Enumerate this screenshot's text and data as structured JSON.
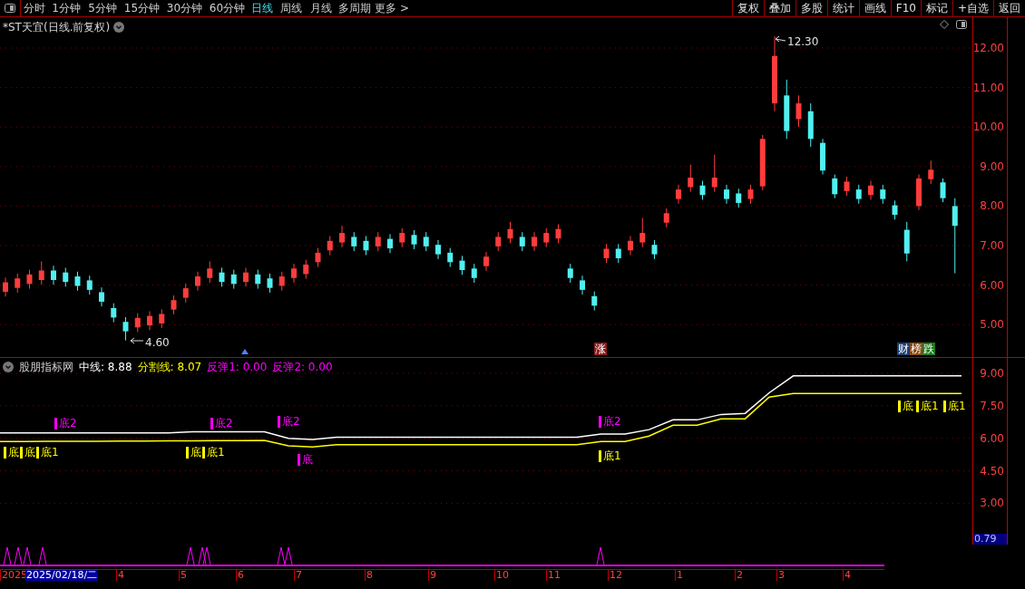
{
  "toolbar": {
    "periods": [
      {
        "label": "分时",
        "selected": false
      },
      {
        "label": "1分钟",
        "selected": false
      },
      {
        "label": "5分钟",
        "selected": false
      },
      {
        "label": "15分钟",
        "selected": false
      },
      {
        "label": "30分钟",
        "selected": false
      },
      {
        "label": "60分钟",
        "selected": false
      },
      {
        "label": "日线",
        "selected": true
      },
      {
        "label": "周线",
        "selected": false
      },
      {
        "label": "月线",
        "selected": false
      },
      {
        "label": "多周期",
        "selected": false
      },
      {
        "label": "更多 >",
        "selected": false
      }
    ],
    "buttons": [
      "复权",
      "叠加",
      "多股",
      "统计",
      "画线",
      "F10",
      "标记",
      "+自选",
      "返回"
    ]
  },
  "chart": {
    "title": "*ST天宜(日线.前复权)",
    "high_label": "12.30",
    "low_label": "4.60",
    "chart_data": {
      "type": "candlestick",
      "grid": true,
      "ylim": [
        4.18,
        12.78
      ],
      "yticks": [
        {
          "value": 12,
          "label": "12.00"
        },
        {
          "value": 11,
          "label": "11.00"
        },
        {
          "value": 10,
          "label": "10.00"
        },
        {
          "value": 9,
          "label": "9.00"
        },
        {
          "value": 8,
          "label": "8.00"
        },
        {
          "value": 7,
          "label": "7.00"
        },
        {
          "value": 6,
          "label": "6.00"
        },
        {
          "value": 5,
          "label": "5.00"
        }
      ],
      "ohlc": [
        [
          5.83,
          6.19,
          5.71,
          6.07
        ],
        [
          5.93,
          6.29,
          5.81,
          6.17
        ],
        [
          6.03,
          6.39,
          5.91,
          6.27
        ],
        [
          6.13,
          6.6,
          6.01,
          6.37
        ],
        [
          6.37,
          6.49,
          6.01,
          6.13
        ],
        [
          6.32,
          6.44,
          5.96,
          6.08
        ],
        [
          6.22,
          6.34,
          5.86,
          5.98
        ],
        [
          6.12,
          6.24,
          5.76,
          5.88
        ],
        [
          5.82,
          5.94,
          5.46,
          5.58
        ],
        [
          5.42,
          5.54,
          5.06,
          5.18
        ],
        [
          5.07,
          5.19,
          4.6,
          4.83
        ],
        [
          4.93,
          5.29,
          4.81,
          5.17
        ],
        [
          4.98,
          5.34,
          4.86,
          5.22
        ],
        [
          5.03,
          5.39,
          4.91,
          5.27
        ],
        [
          5.38,
          5.74,
          5.26,
          5.62
        ],
        [
          5.68,
          6.04,
          5.56,
          5.92
        ],
        [
          5.98,
          6.34,
          5.86,
          6.22
        ],
        [
          6.18,
          6.6,
          6.06,
          6.42
        ],
        [
          6.32,
          6.44,
          5.96,
          6.08
        ],
        [
          6.27,
          6.39,
          5.91,
          6.03
        ],
        [
          6.08,
          6.44,
          5.96,
          6.32
        ],
        [
          6.27,
          6.39,
          5.91,
          6.03
        ],
        [
          6.17,
          6.29,
          5.81,
          5.93
        ],
        [
          5.98,
          6.34,
          5.86,
          6.22
        ],
        [
          6.18,
          6.54,
          6.06,
          6.42
        ],
        [
          6.28,
          6.64,
          6.16,
          6.52
        ],
        [
          6.58,
          6.94,
          6.46,
          6.82
        ],
        [
          6.88,
          7.24,
          6.76,
          7.12
        ],
        [
          7.08,
          7.5,
          6.96,
          7.32
        ],
        [
          7.22,
          7.34,
          6.86,
          6.98
        ],
        [
          7.12,
          7.24,
          6.76,
          6.88
        ],
        [
          6.98,
          7.34,
          6.86,
          7.22
        ],
        [
          7.17,
          7.29,
          6.81,
          6.93
        ],
        [
          7.08,
          7.44,
          6.96,
          7.32
        ],
        [
          7.27,
          7.39,
          6.91,
          7.03
        ],
        [
          7.22,
          7.34,
          6.86,
          6.98
        ],
        [
          7.02,
          7.14,
          6.66,
          6.78
        ],
        [
          6.82,
          6.94,
          6.46,
          6.58
        ],
        [
          6.62,
          6.74,
          6.26,
          6.38
        ],
        [
          6.42,
          6.54,
          6.06,
          6.18
        ],
        [
          6.48,
          6.84,
          6.36,
          6.72
        ],
        [
          6.98,
          7.34,
          6.86,
          7.22
        ],
        [
          7.18,
          7.6,
          7.06,
          7.42
        ],
        [
          7.22,
          7.34,
          6.86,
          6.98
        ],
        [
          6.98,
          7.34,
          6.86,
          7.22
        ],
        [
          7.08,
          7.44,
          6.96,
          7.32
        ],
        [
          7.18,
          7.54,
          7.06,
          7.42
        ],
        [
          6.42,
          6.54,
          6.06,
          6.18
        ],
        [
          6.12,
          6.24,
          5.76,
          5.88
        ],
        [
          5.72,
          5.84,
          5.36,
          5.48
        ],
        [
          6.68,
          7.04,
          6.56,
          6.92
        ],
        [
          6.92,
          7.04,
          6.56,
          6.68
        ],
        [
          6.88,
          7.24,
          6.76,
          7.12
        ],
        [
          7.08,
          7.7,
          6.96,
          7.32
        ],
        [
          7.02,
          7.14,
          6.66,
          6.78
        ],
        [
          7.58,
          7.94,
          7.46,
          7.82
        ],
        [
          8.18,
          8.54,
          8.06,
          8.42
        ],
        [
          8.48,
          9.05,
          8.36,
          8.72
        ],
        [
          8.52,
          8.64,
          8.16,
          8.28
        ],
        [
          8.48,
          9.3,
          8.36,
          8.72
        ],
        [
          8.42,
          8.54,
          8.06,
          8.18
        ],
        [
          8.32,
          8.44,
          7.96,
          8.08
        ],
        [
          8.18,
          8.54,
          8.06,
          8.42
        ],
        [
          8.5,
          9.8,
          8.4,
          9.7
        ],
        [
          10.6,
          12.3,
          10.4,
          11.8
        ],
        [
          10.8,
          11.2,
          9.7,
          9.9
        ],
        [
          10.2,
          10.8,
          10.0,
          10.6
        ],
        [
          10.4,
          10.6,
          9.5,
          9.7
        ],
        [
          9.6,
          9.7,
          8.8,
          8.9
        ],
        [
          8.7,
          8.8,
          8.2,
          8.3
        ],
        [
          8.38,
          8.74,
          8.26,
          8.62
        ],
        [
          8.42,
          8.54,
          8.06,
          8.18
        ],
        [
          8.28,
          8.64,
          8.16,
          8.52
        ],
        [
          8.42,
          8.54,
          8.06,
          8.18
        ],
        [
          8.02,
          8.14,
          7.66,
          7.78
        ],
        [
          7.4,
          7.6,
          6.6,
          6.8
        ],
        [
          8.0,
          8.8,
          7.9,
          8.7
        ],
        [
          8.68,
          9.15,
          8.56,
          8.92
        ],
        [
          8.6,
          8.7,
          8.1,
          8.2
        ],
        [
          8.0,
          8.2,
          6.3,
          7.5
        ]
      ]
    },
    "event_marks": [
      {
        "chars": [
          {
            "text": "涨",
            "color": "#8b1c1c"
          }
        ]
      },
      {
        "chars": [
          {
            "text": "财",
            "color": "#1d3f73"
          },
          {
            "text": "榜",
            "color": "#8a4a12"
          },
          {
            "text": "跌",
            "color": "#1c7a1c"
          }
        ]
      }
    ]
  },
  "indicator": {
    "name": "股朋指标网",
    "values": [
      {
        "label": "中线: 8.88",
        "color": "#ffffff"
      },
      {
        "label": "分割线: 8.07",
        "color": "#ffff00"
      },
      {
        "label": "反弹1: 0.00",
        "color": "#ff00ff"
      },
      {
        "label": "反弹2: 0.00",
        "color": "#ff00ff"
      }
    ],
    "chart_data": {
      "type": "line",
      "grid": true,
      "ylim": [
        1.05,
        9.71
      ],
      "yticks": [
        {
          "value": 9,
          "label": "9.00"
        },
        {
          "value": 7.5,
          "label": "7.50"
        },
        {
          "value": 6,
          "label": "6.00"
        },
        {
          "value": 4.5,
          "label": "4.50"
        },
        {
          "value": 3,
          "label": "3.00"
        }
      ],
      "series": [
        {
          "color": "#ffffff",
          "values": [
            6.25,
            6.25,
            6.25,
            6.25,
            6.25,
            6.25,
            6.25,
            6.25,
            6.3,
            6.3,
            6.3,
            6.3,
            6.0,
            5.95,
            6.05,
            6.05,
            6.05,
            6.05,
            6.05,
            6.05,
            6.05,
            6.05,
            6.05,
            6.05,
            6.05,
            6.2,
            6.2,
            6.4,
            6.85,
            6.85,
            7.1,
            7.15,
            8.1,
            8.88,
            8.88,
            8.88,
            8.88,
            8.88,
            8.88,
            8.88,
            8.88
          ]
        },
        {
          "color": "#ffff00",
          "values": [
            5.85,
            5.85,
            5.86,
            5.86,
            5.86,
            5.87,
            5.87,
            5.88,
            5.88,
            5.89,
            5.89,
            5.9,
            5.65,
            5.6,
            5.7,
            5.7,
            5.7,
            5.7,
            5.7,
            5.7,
            5.7,
            5.7,
            5.7,
            5.7,
            5.7,
            5.85,
            5.85,
            6.1,
            6.6,
            6.6,
            6.9,
            6.9,
            7.9,
            8.07,
            8.07,
            8.07,
            8.07,
            8.07,
            8.07,
            8.07,
            8.07
          ]
        }
      ]
    },
    "signals": [
      {
        "text": "底",
        "kind": "bottom"
      },
      {
        "text": "底",
        "kind": "bottom"
      },
      {
        "text": "底1",
        "kind": "bottom"
      },
      {
        "text": "底2",
        "kind": "rebound"
      },
      {
        "text": "底",
        "kind": "bottom"
      },
      {
        "text": "底1",
        "kind": "bottom"
      },
      {
        "text": "底2",
        "kind": "rebound"
      },
      {
        "text": "底2",
        "kind": "rebound"
      },
      {
        "text": "底",
        "kind": "rebound"
      },
      {
        "text": "底2",
        "kind": "rebound"
      },
      {
        "text": "底1",
        "kind": "bottom"
      },
      {
        "text": "底",
        "kind": "bottom"
      },
      {
        "text": "底1",
        "kind": "bottom"
      },
      {
        "text": "底1",
        "kind": "bottom"
      }
    ],
    "readout": "0.79"
  },
  "timeline": {
    "labels": [
      "2025",
      "4",
      "5",
      "6",
      "7",
      "8",
      "9",
      "10",
      "11",
      "12",
      "1",
      "2",
      "3",
      "4"
    ],
    "cursor": "2025/02/18/二"
  }
}
